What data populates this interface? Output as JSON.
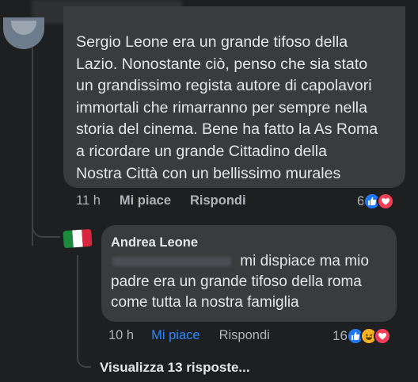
{
  "main_comment": {
    "text_lines": [
      "Sergio Leone era un grande tifoso della",
      "Lazio. Nonostante ciò, penso che sia stato",
      "un grandissimo regista autore di capolavori",
      "immortali che rimarranno per sempre nella",
      "storia del cinema. Bene ha fatto la As Roma",
      "a ricordare un grande Cittadino della",
      "Nostra Città con un bellissimo murales"
    ],
    "time": "11 h",
    "like_label": "Mi piace",
    "reply_label": "Rispondi",
    "reaction_count": "6",
    "reactions": [
      "like-icon",
      "love-icon"
    ]
  },
  "reply_comment": {
    "author": "Andrea Leone",
    "text_lines": [
      "mi dispiace ma mio",
      "padre era un grande tifoso della roma",
      "come tutta la nostra famiglia"
    ],
    "time": "10 h",
    "like_label": "Mi piace",
    "reply_label": "Rispondi",
    "reaction_count": "16",
    "reactions": [
      "like-icon",
      "haha-icon",
      "love-icon"
    ],
    "avatar_flag_colors": [
      "#1b8a3c",
      "#ffffff",
      "#d7263d"
    ]
  },
  "view_replies_label": "Visualizza 13 risposte...",
  "colors": {
    "background": "#1e1f21",
    "bubble": "#3a3b3c",
    "text": "#e4e6eb",
    "secondary_text": "#b0b3b8",
    "liked_blue": "#2d88ff"
  }
}
